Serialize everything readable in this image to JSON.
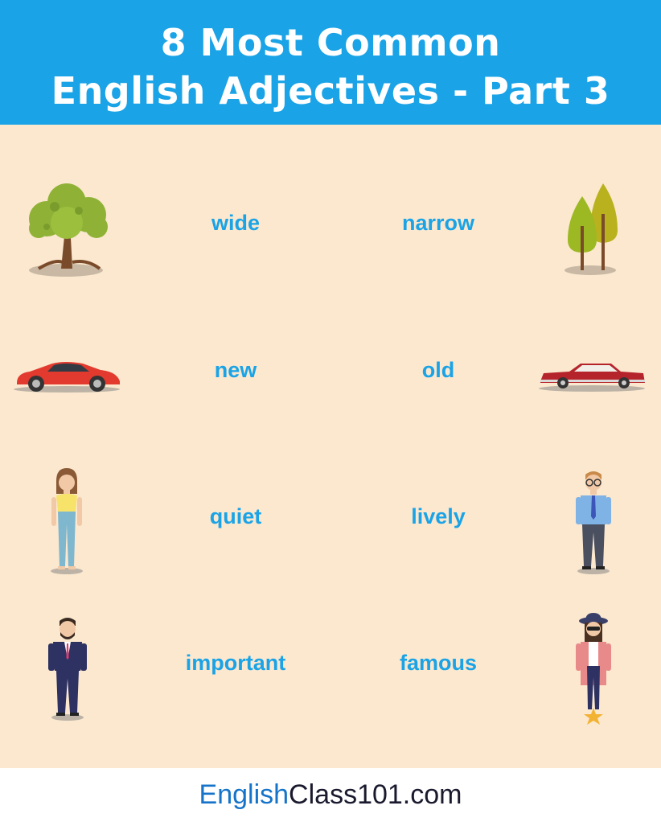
{
  "header": {
    "title_line1": "8 Most Common",
    "title_line2": "English Adjectives - Part 3"
  },
  "rows": [
    {
      "left_word": "wide",
      "right_word": "narrow",
      "left_icon": "wide-tree-icon",
      "right_icon": "narrow-trees-icon"
    },
    {
      "left_word": "new",
      "right_word": "old",
      "left_icon": "new-sports-car-icon",
      "right_icon": "old-car-icon"
    },
    {
      "left_word": "quiet",
      "right_word": "lively",
      "left_icon": "quiet-woman-icon",
      "right_icon": "lively-man-icon"
    },
    {
      "left_word": "important",
      "right_word": "famous",
      "left_icon": "important-businessman-icon",
      "right_icon": "famous-woman-icon"
    }
  ],
  "footer": {
    "site_part1": "English",
    "site_part2": "Class101.com"
  },
  "colors": {
    "header_bg": "#1aa3e6",
    "panel_bg": "#fbe8cf",
    "word_color": "#1aa3e6",
    "footer_blue": "#1574c9"
  }
}
